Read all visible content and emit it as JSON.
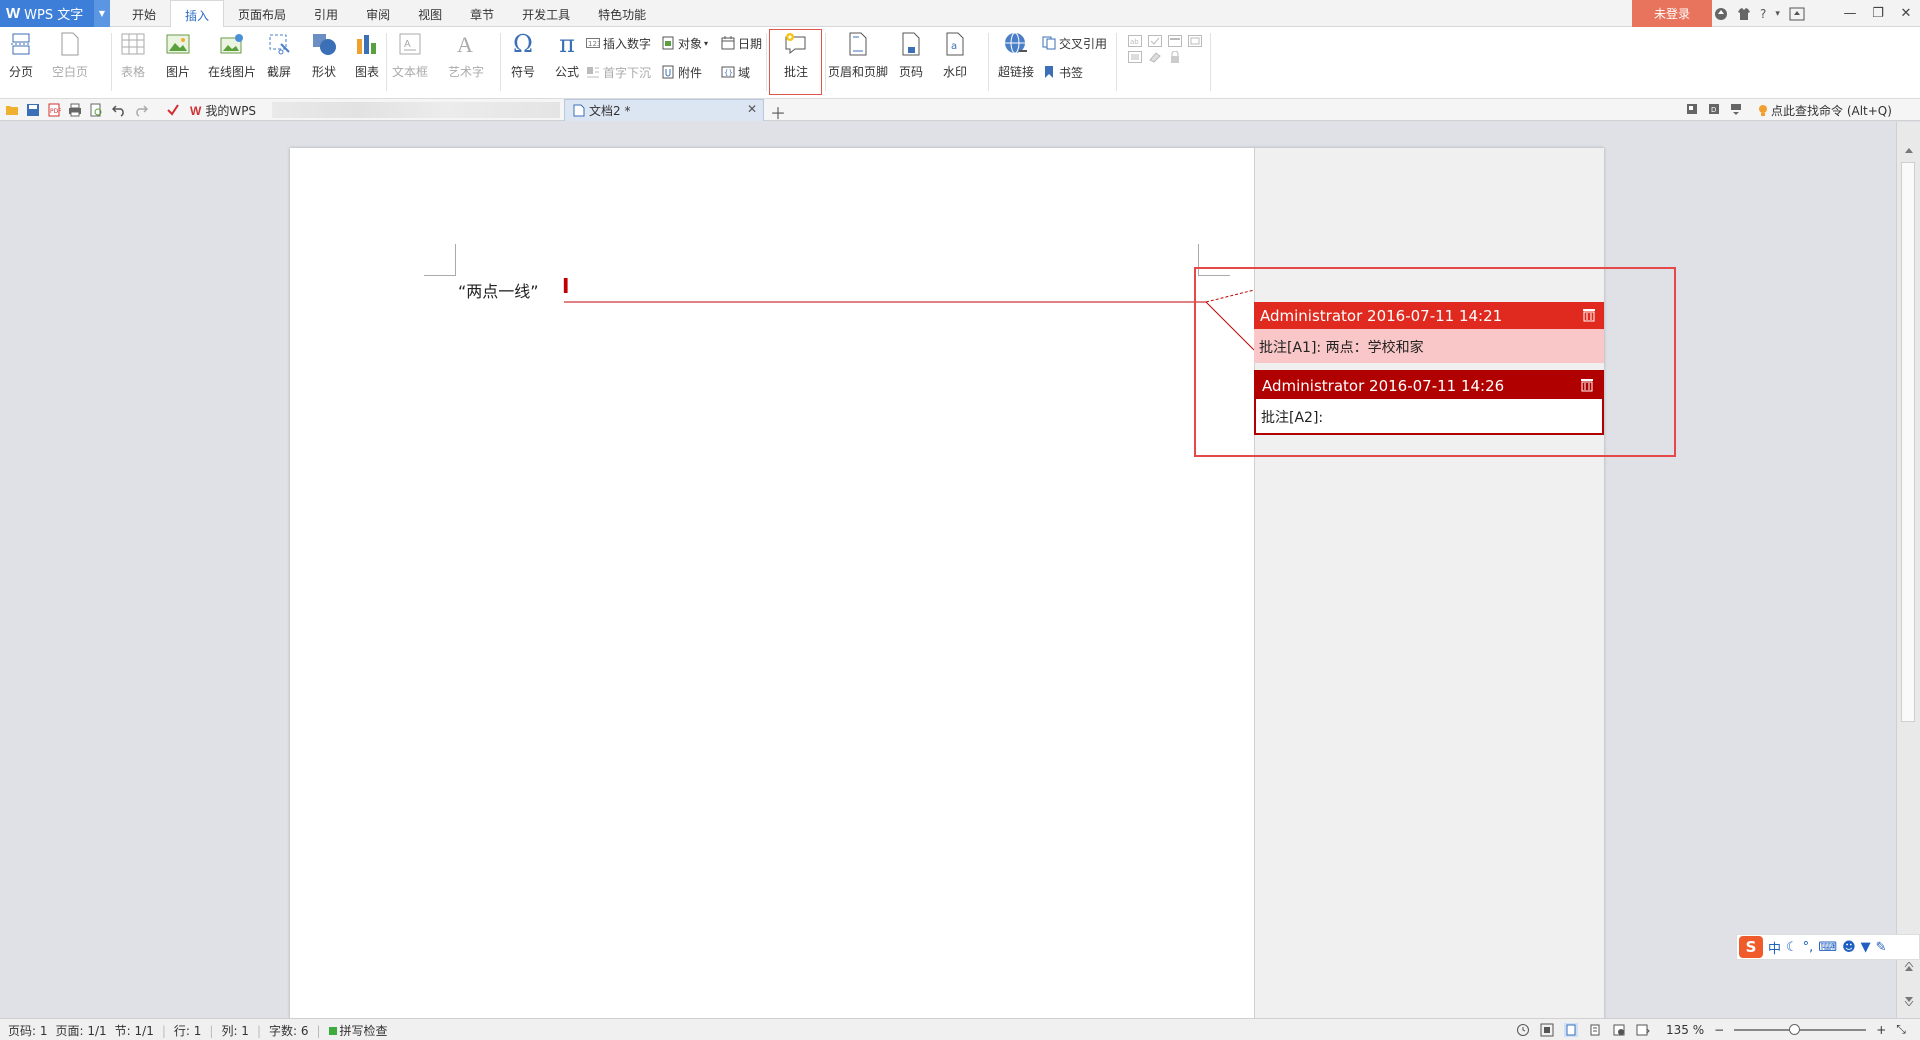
{
  "app": {
    "name": "WPS 文字",
    "logo_letter": "W"
  },
  "ribbon_tabs": [
    "开始",
    "插入",
    "页面布局",
    "引用",
    "审阅",
    "视图",
    "章节",
    "开发工具",
    "特色功能"
  ],
  "active_tab": "插入",
  "login_label": "未登录",
  "title_icons": [
    "?"
  ],
  "ribbon": {
    "page_break": "分页",
    "blank_page": "空白页",
    "table": "表格",
    "picture": "图片",
    "online_picture": "在线图片",
    "screenshot": "截屏",
    "shapes": "形状",
    "chart": "图表",
    "textbox": "文本框",
    "wordart": "艺术字",
    "symbol": "符号",
    "formula": "公式",
    "insert_number": "插入数字",
    "object": "对象",
    "date": "日期",
    "dropcap": "首字下沉",
    "attachment": "附件",
    "field": "域",
    "comment": "批注",
    "header_footer": "页眉和页脚",
    "page_number": "页码",
    "watermark": "水印",
    "hyperlink": "超链接",
    "cross_ref": "交叉引用",
    "bookmark": "书签"
  },
  "qbar": {
    "mywps": "我的WPS",
    "doc_tab": "文档2 *",
    "find_command": "点此查找命令 (Alt+Q)"
  },
  "document": {
    "body_text": "“两点一线”"
  },
  "comments": [
    {
      "author_time": "Administrator 2016-07-11 14:21",
      "text": "批注[A1]: 两点：学校和家",
      "color": "#e02a1f"
    },
    {
      "author_time": "Administrator 2016-07-11 14:26",
      "text": "批注[A2]: ",
      "color": "#b00000"
    }
  ],
  "ime": {
    "lang": "中"
  },
  "status": {
    "page": "页码: 1",
    "pages": "页面: 1/1",
    "section": "节: 1/1",
    "row": "行: 1",
    "col": "列: 1",
    "words": "字数: 6",
    "spell": "拼写检查",
    "zoom": "135 %",
    "zoom_fraction": 0.45
  },
  "colors": {
    "accent": "#3d7fd8",
    "login": "#e8745e",
    "annotation_frame": "#e44848"
  }
}
